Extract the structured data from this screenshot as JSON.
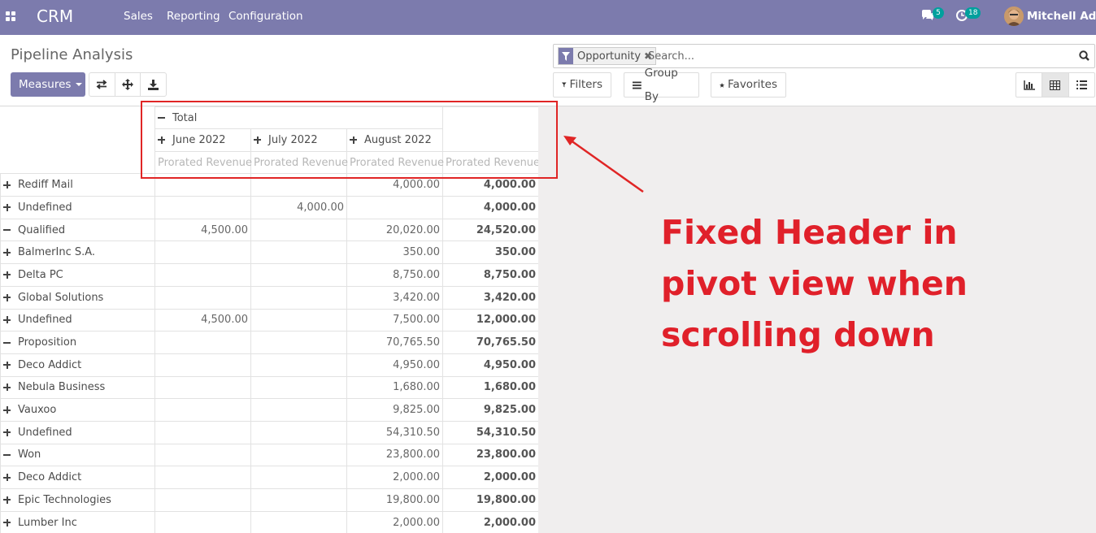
{
  "navbar": {
    "app_name": "CRM",
    "menu": [
      "Sales",
      "Reporting",
      "Configuration"
    ],
    "messages_count": "5",
    "activities_count": "18",
    "user_name": "Mitchell Admin",
    "bg_color": "#7c7bad",
    "badge_color": "#00a09d"
  },
  "control_panel": {
    "title": "Pipeline Analysis",
    "measures_label": "Measures",
    "search": {
      "facet_label": "Opportunity",
      "placeholder": "Search..."
    },
    "filters_label": "Filters",
    "group_by_label": "Group By",
    "favorites_label": "Favorites",
    "views": [
      "graph-icon",
      "pivot-icon",
      "list-icon"
    ],
    "active_view": "pivot-icon"
  },
  "pivot": {
    "header_total": "Total",
    "columns": [
      "June 2022",
      "July 2022",
      "August 2022"
    ],
    "measure": "Prorated Revenue",
    "rows": [
      {
        "label": "Rediff Mail",
        "level": 2,
        "expanded": false,
        "values": [
          "",
          "",
          "4,000.00"
        ],
        "total": "4,000.00"
      },
      {
        "label": "Undefined",
        "level": 2,
        "expanded": false,
        "values": [
          "",
          "4,000.00",
          ""
        ],
        "total": "4,000.00"
      },
      {
        "label": "Qualified",
        "level": 1,
        "expanded": true,
        "values": [
          "4,500.00",
          "",
          "20,020.00"
        ],
        "total": "24,520.00"
      },
      {
        "label": "BalmerInc S.A.",
        "level": 2,
        "expanded": false,
        "values": [
          "",
          "",
          "350.00"
        ],
        "total": "350.00"
      },
      {
        "label": "Delta PC",
        "level": 2,
        "expanded": false,
        "values": [
          "",
          "",
          "8,750.00"
        ],
        "total": "8,750.00"
      },
      {
        "label": "Global Solutions",
        "level": 2,
        "expanded": false,
        "values": [
          "",
          "",
          "3,420.00"
        ],
        "total": "3,420.00"
      },
      {
        "label": "Undefined",
        "level": 2,
        "expanded": false,
        "values": [
          "4,500.00",
          "",
          "7,500.00"
        ],
        "total": "12,000.00"
      },
      {
        "label": "Proposition",
        "level": 1,
        "expanded": true,
        "values": [
          "",
          "",
          "70,765.50"
        ],
        "total": "70,765.50"
      },
      {
        "label": "Deco Addict",
        "level": 2,
        "expanded": false,
        "values": [
          "",
          "",
          "4,950.00"
        ],
        "total": "4,950.00"
      },
      {
        "label": "Nebula Business",
        "level": 2,
        "expanded": false,
        "values": [
          "",
          "",
          "1,680.00"
        ],
        "total": "1,680.00"
      },
      {
        "label": "Vauxoo",
        "level": 2,
        "expanded": false,
        "values": [
          "",
          "",
          "9,825.00"
        ],
        "total": "9,825.00"
      },
      {
        "label": "Undefined",
        "level": 2,
        "expanded": false,
        "values": [
          "",
          "",
          "54,310.50"
        ],
        "total": "54,310.50"
      },
      {
        "label": "Won",
        "level": 1,
        "expanded": true,
        "values": [
          "",
          "",
          "23,800.00"
        ],
        "total": "23,800.00"
      },
      {
        "label": "Deco Addict",
        "level": 2,
        "expanded": false,
        "values": [
          "",
          "",
          "2,000.00"
        ],
        "total": "2,000.00"
      },
      {
        "label": "Epic Technologies",
        "level": 2,
        "expanded": false,
        "values": [
          "",
          "",
          "19,800.00"
        ],
        "total": "19,800.00"
      },
      {
        "label": "Lumber Inc",
        "level": 2,
        "expanded": false,
        "values": [
          "",
          "",
          "2,000.00"
        ],
        "total": "2,000.00"
      }
    ]
  },
  "annotation": {
    "text_lines": [
      "Fixed Header in",
      "pivot view when",
      "scrolling down"
    ],
    "color": "#e0202a"
  }
}
